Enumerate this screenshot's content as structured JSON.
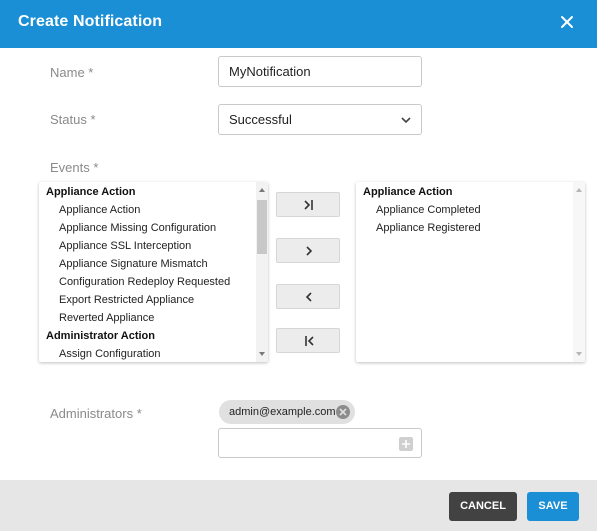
{
  "dialog": {
    "title": "Create Notification"
  },
  "form": {
    "name_label": "Name *",
    "name_value": "MyNotification",
    "status_label": "Status *",
    "status_value": "Successful",
    "events_label": "Events *",
    "administrators_label": "Administrators *"
  },
  "available_events": [
    {
      "type": "group",
      "label": "Appliance Action"
    },
    {
      "type": "item",
      "label": "Appliance Action"
    },
    {
      "type": "item",
      "label": "Appliance Missing Configuration"
    },
    {
      "type": "item",
      "label": "Appliance SSL Interception"
    },
    {
      "type": "item",
      "label": "Appliance Signature Mismatch"
    },
    {
      "type": "item",
      "label": "Configuration Redeploy Requested"
    },
    {
      "type": "item",
      "label": "Export Restricted Appliance"
    },
    {
      "type": "item",
      "label": "Reverted Appliance"
    },
    {
      "type": "group",
      "label": "Administrator Action"
    },
    {
      "type": "item",
      "label": "Assign Configuration"
    }
  ],
  "selected_events": [
    {
      "type": "group",
      "label": "Appliance Action"
    },
    {
      "type": "item",
      "label": "Appliance Completed"
    },
    {
      "type": "item",
      "label": "Appliance Registered"
    }
  ],
  "administrators": {
    "chips": [
      "admin@example.com"
    ],
    "input_value": ""
  },
  "footer": {
    "cancel_label": "CANCEL",
    "save_label": "SAVE"
  },
  "colors": {
    "accent": "#1a8fd6",
    "cancel": "#424242"
  }
}
